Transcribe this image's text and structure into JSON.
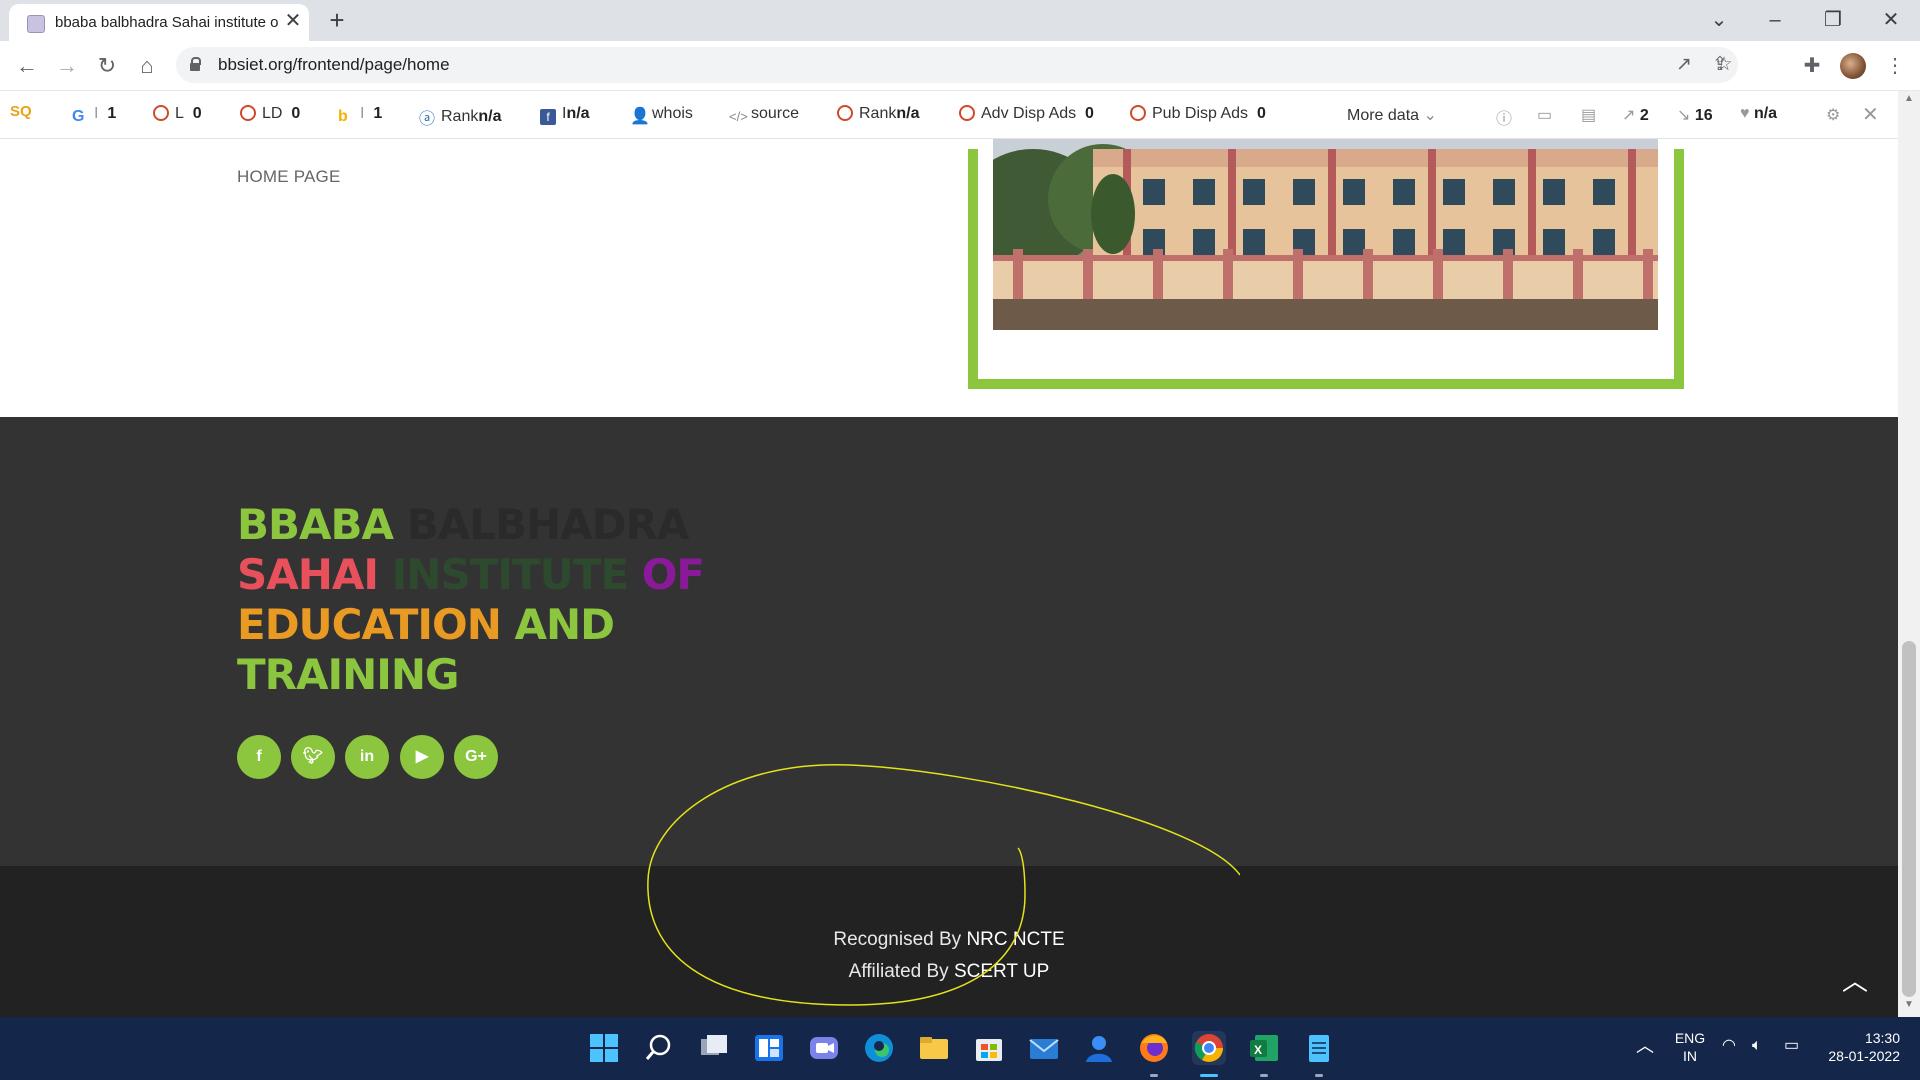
{
  "browser": {
    "tab_title": "bbaba balbhadra Sahai institute o",
    "url": "bbsiet.org/frontend/page/home"
  },
  "seoquake": {
    "items": [
      {
        "label": "G",
        "sep": "I",
        "value": "1"
      },
      {
        "label": "L",
        "value": "0"
      },
      {
        "label": "LD",
        "value": "0"
      },
      {
        "label": "b",
        "sep": "I",
        "value": "1"
      },
      {
        "label": "Rank",
        "value": "n/a"
      },
      {
        "label": "I",
        "value": "n/a"
      },
      {
        "label": "whois"
      },
      {
        "label": "source"
      },
      {
        "label": "Rank",
        "value": "n/a"
      },
      {
        "label": "Adv Disp Ads",
        "value": "0"
      },
      {
        "label": "Pub Disp Ads",
        "value": "0"
      }
    ],
    "more_data": "More data",
    "right_values": [
      "2",
      "16",
      "n/a"
    ]
  },
  "page": {
    "breadcrumb": "HOME PAGE",
    "footer_title_words": [
      {
        "text": "BBABA",
        "color": "#8cc63f"
      },
      {
        "text": "BALBHADRA",
        "color": "#2a2a2a"
      },
      {
        "text": "SAHAI",
        "color": "#e8505b"
      },
      {
        "text": "INSTITUTE",
        "color": "#2e4a2e"
      },
      {
        "text": "OF",
        "color": "#8b1a9b"
      },
      {
        "text": "EDUCATION",
        "color": "#e89a23"
      },
      {
        "text": "AND",
        "color": "#8cc63f"
      },
      {
        "text": "TRAINING",
        "color": "#8cc63f"
      }
    ],
    "social": [
      "f",
      "t",
      "in",
      "yt",
      "G+"
    ],
    "recognised_prefix": "Recognised By",
    "recognised_by": "NRC NCTE",
    "affiliated_prefix": "Affiliated By",
    "affiliated_by": "SCERT UP"
  },
  "tray": {
    "lang": "ENG",
    "region": "IN",
    "time": "13:30",
    "date": "28-01-2022"
  },
  "colors": {
    "accent_green": "#8cc63f",
    "footer_dark": "#333333",
    "footer_darker": "#222222",
    "taskbar": "#14264a"
  }
}
